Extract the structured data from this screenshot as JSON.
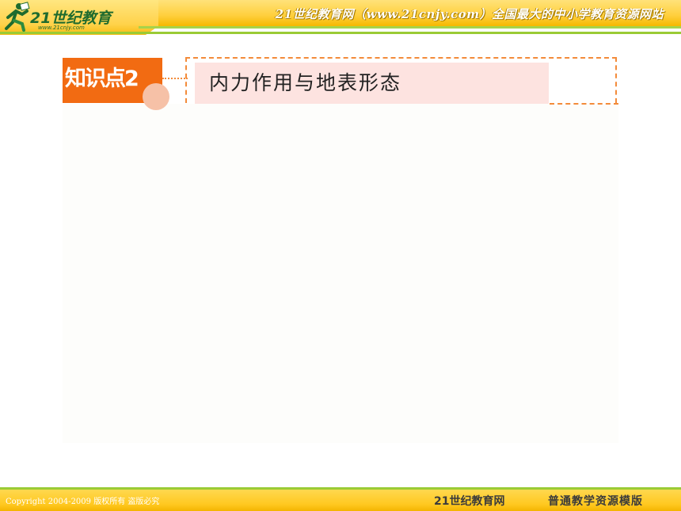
{
  "header": {
    "logo_text": "21世纪教育",
    "logo_url": "www.21cnjy.com",
    "slogan": "21世纪教育网（www.21cnjy.com）全国最大的中小学教育资源网站"
  },
  "knowledge_point": {
    "label": "知识点2",
    "title": "内力作用与地表形态"
  },
  "footer": {
    "copyright": "Copyright 2004-2009 版权所有 盗版必究",
    "brand": "21世纪教育网",
    "tagline": "普通教学资源模版"
  },
  "colors": {
    "accent_orange": "#f26b12",
    "title_bg": "#fde3e0",
    "header_yellow": "#ffcf3c",
    "line_green": "#9acb35"
  }
}
